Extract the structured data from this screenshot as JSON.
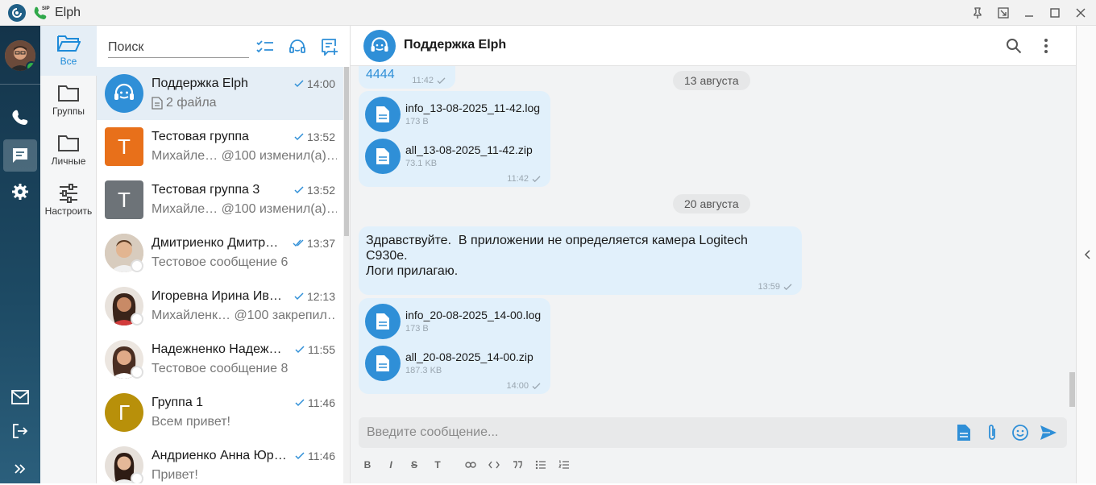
{
  "window": {
    "title": "Elph"
  },
  "folders": [
    {
      "label": "Все",
      "icon": "folder-open-icon",
      "active": true
    },
    {
      "label": "Группы",
      "icon": "folder-icon"
    },
    {
      "label": "Личные",
      "icon": "folder-icon"
    },
    {
      "label": "Настроить",
      "icon": "sliders-icon"
    }
  ],
  "search": {
    "placeholder": "Поиск"
  },
  "chats": [
    {
      "name": "Поддержка Elph",
      "time": "14:00",
      "preview": "2 файла",
      "avatar": "support-avatar",
      "color": "#2f8fd7",
      "active": true
    },
    {
      "name": "Тестовая группа",
      "time": "13:52",
      "preview": "Михайле…  @100 изменил(а)…",
      "initial": "Т",
      "color": "#e8701a"
    },
    {
      "name": "Тестовая группа 3",
      "time": "13:52",
      "preview": "Михайле…  @100 изменил(а)…",
      "initial": "Т",
      "color": "#6d7378"
    },
    {
      "name": "Дмитриенко Дмитр…",
      "time": "13:37",
      "preview": "Тестовое сообщение 6",
      "avatar": "photo"
    },
    {
      "name": "Игоревна Ирина Ив…",
      "time": "12:13",
      "preview": "Михайленк…  @100 закрепил…",
      "avatar": "photo"
    },
    {
      "name": "Надежненко Надеж…",
      "time": "11:55",
      "preview": "Тестовое сообщение 8",
      "avatar": "photo"
    },
    {
      "name": "Группа 1",
      "time": "11:46",
      "preview": "Всем привет!",
      "initial": "Г",
      "color": "#b8900a"
    },
    {
      "name": "Андриенко Анна Юр…",
      "time": "11:46",
      "preview": "Привет!",
      "avatar": "photo"
    }
  ],
  "chat": {
    "title": "Поддержка Elph",
    "messages": {
      "partial_text": "4444",
      "partial_time": "11:42",
      "date1": "13 августа",
      "files1": [
        {
          "name": "info_13-08-2025_11-42.log",
          "size": "173 B"
        },
        {
          "name": "all_13-08-2025_11-42.zip",
          "size": "73.1 KB"
        }
      ],
      "files1_time": "11:42",
      "date2": "20 августа",
      "text_lines": [
        "Здравствуйте.  В приложении не определяется камера Logitech",
        "C930e.",
        "Логи прилагаю."
      ],
      "text_time": "13:59",
      "files2": [
        {
          "name": "info_20-08-2025_14-00.log",
          "size": "173 B"
        },
        {
          "name": "all_20-08-2025_14-00.zip",
          "size": "187.3 KB"
        }
      ],
      "files2_time": "14:00"
    },
    "composer_placeholder": "Введите сообщение..."
  },
  "colors": {
    "accent": "#2f8fd7",
    "bubble": "#e1f0fb",
    "rail": "#14344a"
  }
}
